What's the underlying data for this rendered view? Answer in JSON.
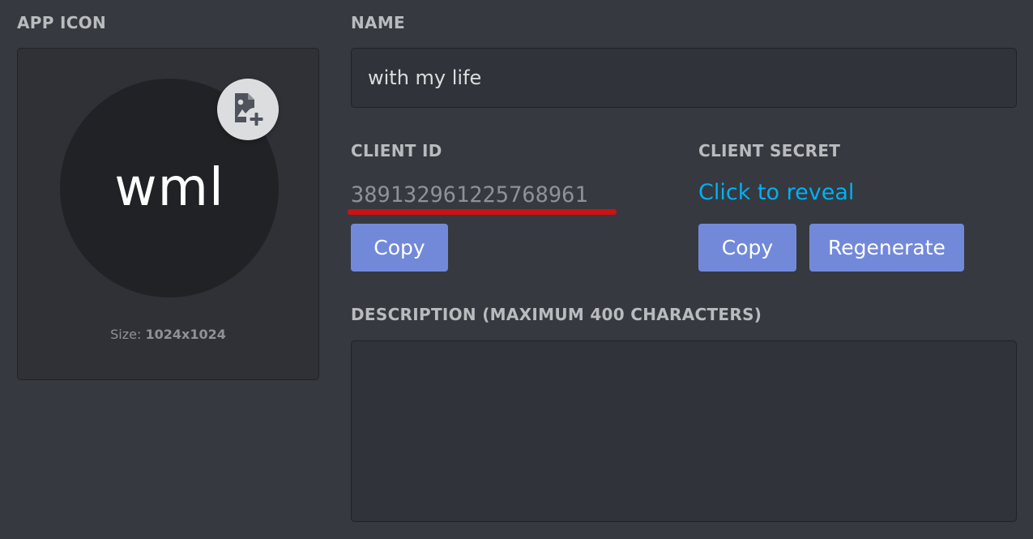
{
  "app_icon": {
    "label": "APP ICON",
    "avatar_text": "wml",
    "upload_icon": "image-plus-icon",
    "size_label": "Size:",
    "size_value": "1024x1024"
  },
  "name": {
    "label": "NAME",
    "value": "with my life"
  },
  "client_id": {
    "label": "CLIENT ID",
    "value": "389132961225768961",
    "copy_label": "Copy",
    "highlight_color": "#cc1212"
  },
  "client_secret": {
    "label": "CLIENT SECRET",
    "reveal_text": "Click to reveal",
    "copy_label": "Copy",
    "regenerate_label": "Regenerate"
  },
  "description": {
    "label": "DESCRIPTION (MAXIMUM 400 CHARACTERS)",
    "value": ""
  },
  "colors": {
    "background": "#36393f",
    "panel": "#2f3136",
    "input": "#303339",
    "button": "#7289da",
    "link": "#00b0f4",
    "label": "#b9bbbe"
  }
}
